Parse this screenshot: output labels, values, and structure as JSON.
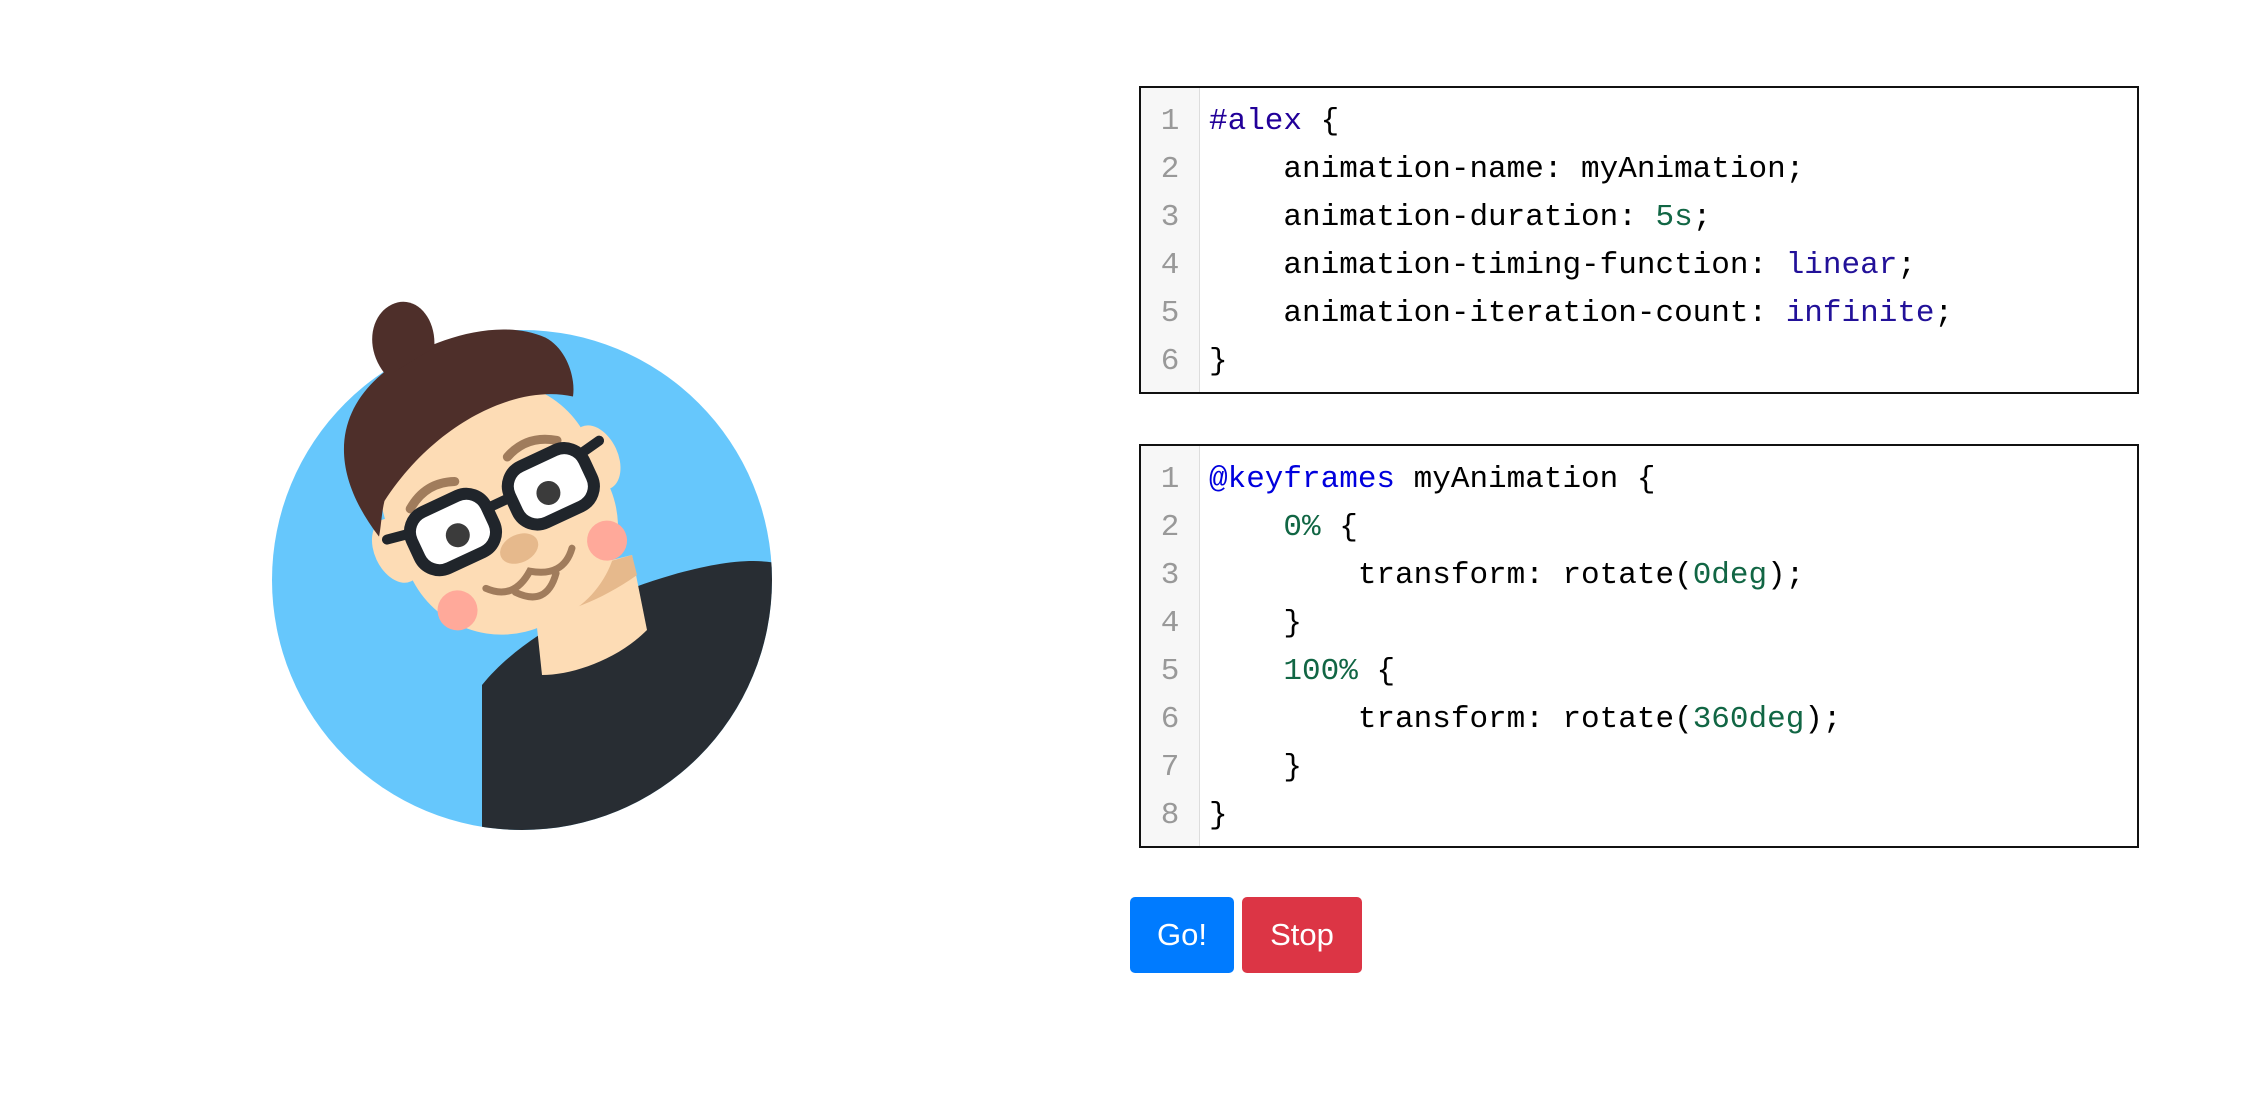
{
  "editor_css": {
    "lines": [
      {
        "n": "1",
        "tokens": [
          {
            "t": "#alex",
            "c": "tok-selector"
          },
          {
            "t": " {",
            "c": "tok-plain"
          }
        ]
      },
      {
        "n": "2",
        "tokens": [
          {
            "t": "    animation-name: myAnimation;",
            "c": "tok-plain"
          }
        ]
      },
      {
        "n": "3",
        "tokens": [
          {
            "t": "    animation-duration: ",
            "c": "tok-plain"
          },
          {
            "t": "5s",
            "c": "tok-number"
          },
          {
            "t": ";",
            "c": "tok-plain"
          }
        ]
      },
      {
        "n": "4",
        "tokens": [
          {
            "t": "    animation-timing-function: ",
            "c": "tok-plain"
          },
          {
            "t": "linear",
            "c": "tok-atom"
          },
          {
            "t": ";",
            "c": "tok-plain"
          }
        ]
      },
      {
        "n": "5",
        "tokens": [
          {
            "t": "    animation-iteration-count: ",
            "c": "tok-plain"
          },
          {
            "t": "infinite",
            "c": "tok-atom"
          },
          {
            "t": ";",
            "c": "tok-plain"
          }
        ]
      },
      {
        "n": "6",
        "tokens": [
          {
            "t": "}",
            "c": "tok-plain"
          }
        ]
      }
    ]
  },
  "editor_keyframes": {
    "lines": [
      {
        "n": "1",
        "tokens": [
          {
            "t": "@keyframes",
            "c": "tok-atrule"
          },
          {
            "t": " myAnimation {",
            "c": "tok-plain"
          }
        ]
      },
      {
        "n": "2",
        "tokens": [
          {
            "t": "    ",
            "c": "tok-plain"
          },
          {
            "t": "0%",
            "c": "tok-number"
          },
          {
            "t": " {",
            "c": "tok-plain"
          }
        ]
      },
      {
        "n": "3",
        "tokens": [
          {
            "t": "        transform: rotate(",
            "c": "tok-plain"
          },
          {
            "t": "0deg",
            "c": "tok-number"
          },
          {
            "t": ");",
            "c": "tok-plain"
          }
        ]
      },
      {
        "n": "4",
        "tokens": [
          {
            "t": "    }",
            "c": "tok-plain"
          }
        ]
      },
      {
        "n": "5",
        "tokens": [
          {
            "t": "    ",
            "c": "tok-plain"
          },
          {
            "t": "100%",
            "c": "tok-number"
          },
          {
            "t": " {",
            "c": "tok-plain"
          }
        ]
      },
      {
        "n": "6",
        "tokens": [
          {
            "t": "        transform: rotate(",
            "c": "tok-plain"
          },
          {
            "t": "360deg",
            "c": "tok-number"
          },
          {
            "t": ");",
            "c": "tok-plain"
          }
        ]
      },
      {
        "n": "7",
        "tokens": [
          {
            "t": "    }",
            "c": "tok-plain"
          }
        ]
      },
      {
        "n": "8",
        "tokens": [
          {
            "t": "}",
            "c": "tok-plain"
          }
        ]
      }
    ]
  },
  "buttons": {
    "go_label": "Go!",
    "stop_label": "Stop"
  },
  "colors": {
    "go_button": "#007bff",
    "stop_button": "#dc3545",
    "avatar_background": "#66c7fc",
    "selector": "#220099",
    "at_rule": "#0000dd",
    "number": "#116644",
    "atom": "#221199"
  },
  "icons": {
    "avatar": "alex-avatar-illustration"
  }
}
